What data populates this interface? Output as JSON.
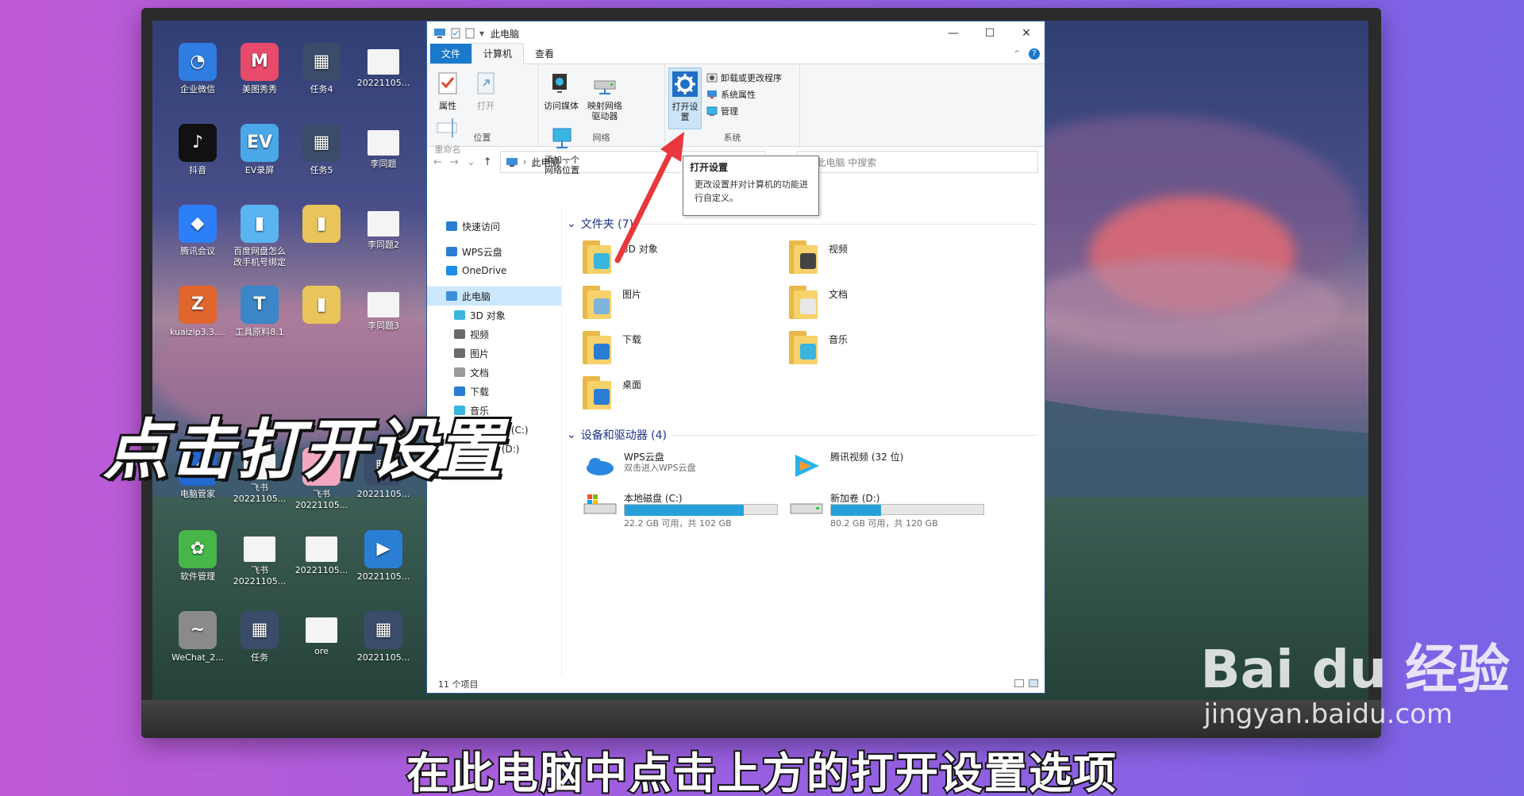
{
  "desktop": {
    "icons": [
      {
        "label": "企业微信",
        "color": "#2f7de1",
        "glyph": "◔"
      },
      {
        "label": "美图秀秀",
        "color": "#e84a6a",
        "glyph": "M"
      },
      {
        "label": "任务4",
        "color": "#3b4c6a",
        "glyph": "▦"
      },
      {
        "label": "20221105...",
        "color": "#f4f4f4",
        "glyph": ""
      },
      {
        "label": "抖音",
        "color": "#111111",
        "glyph": "♪"
      },
      {
        "label": "EV录屏",
        "color": "#4aa8e8",
        "glyph": "EV"
      },
      {
        "label": "任务5",
        "color": "#3b4c6a",
        "glyph": "▦"
      },
      {
        "label": "李同题",
        "color": "#f4f4f4",
        "glyph": ""
      },
      {
        "label": "腾讯会议",
        "color": "#2d7ff9",
        "glyph": "◆"
      },
      {
        "label": "百度网盘怎么改手机号绑定",
        "color": "#5ab4f0",
        "glyph": "▮"
      },
      {
        "label": "",
        "color": "#e8c45a",
        "glyph": "▮"
      },
      {
        "label": "李同题2",
        "color": "#f4f4f4",
        "glyph": ""
      },
      {
        "label": "kuaizip3.3....",
        "color": "#e0662d",
        "glyph": "Z"
      },
      {
        "label": "工具原料8.1",
        "color": "#3a86c8",
        "glyph": "T"
      },
      {
        "label": "",
        "color": "#e8c45a",
        "glyph": "▮"
      },
      {
        "label": "李同题3",
        "color": "#f4f4f4",
        "glyph": ""
      },
      {
        "label": "电脑管家",
        "color": "#2367d1",
        "glyph": "✓"
      },
      {
        "label": "飞书 20221105...",
        "color": "#f4f4f4",
        "glyph": ""
      },
      {
        "label": "飞书 20221105...",
        "color": "#f2a6c0",
        "glyph": "✿"
      },
      {
        "label": "20221105...",
        "color": "#3b4c6a",
        "glyph": "▦"
      },
      {
        "label": "软件管理",
        "color": "#46b649",
        "glyph": "✿"
      },
      {
        "label": "飞书 20221105...",
        "color": "#f4f4f4",
        "glyph": ""
      },
      {
        "label": "20221105...",
        "color": "#f4f4f4",
        "glyph": ""
      },
      {
        "label": "20221105...",
        "color": "#2a7fd4",
        "glyph": "▶"
      },
      {
        "label": "WeChat_2...",
        "color": "#8a8a8a",
        "glyph": "~"
      },
      {
        "label": "任务",
        "color": "#3b4c6a",
        "glyph": "▦"
      },
      {
        "label": "ore",
        "color": "#f4f4f4",
        "glyph": ""
      },
      {
        "label": "20221105...",
        "color": "#3b4c6a",
        "glyph": "▦"
      }
    ]
  },
  "window": {
    "title": "此电脑",
    "controls": {
      "minimize": "—",
      "maximize": "☐",
      "close": "✕"
    },
    "tabs": {
      "file": "文件",
      "computer": "计算机",
      "view": "查看"
    },
    "help": "?",
    "ribbon": {
      "location": {
        "label": "位置",
        "properties": "属性",
        "open": "打开",
        "rename": "重命名"
      },
      "network": {
        "label": "网络",
        "media": "访问媒体",
        "map_drive": "映射网络驱动器",
        "add_location": "添加一个网络位置"
      },
      "system": {
        "label": "系统",
        "settings": "打开设置",
        "uninstall": "卸载或更改程序",
        "sys_props": "系统属性",
        "manage": "管理"
      }
    },
    "nav_bar": {
      "path_root": "此电脑",
      "search_placeholder": "在 此电脑 中搜索"
    },
    "tooltip": {
      "title": "打开设置",
      "desc": "更改设置并对计算机的功能进行自定义。"
    },
    "sidebar": {
      "items": [
        {
          "label": "快速访问",
          "color": "#2b7cd3"
        },
        {
          "label": "WPS云盘",
          "color": "#2b7cd3"
        },
        {
          "label": "OneDrive",
          "color": "#1a8ee6"
        },
        {
          "label": "此电脑",
          "color": "#3b8ed8"
        },
        {
          "label": "3D 对象",
          "color": "#3ab5e0"
        },
        {
          "label": "视频",
          "color": "#6a6a6a"
        },
        {
          "label": "图片",
          "color": "#6a6a6a"
        },
        {
          "label": "文档",
          "color": "#9a9a9a"
        },
        {
          "label": "下载",
          "color": "#2b7cd3"
        },
        {
          "label": "音乐",
          "color": "#3ab5e0"
        },
        {
          "label": "本地磁盘 (C:)",
          "color": "#666666"
        },
        {
          "label": "新加卷 (D:)",
          "color": "#666666"
        },
        {
          "label": "网络",
          "color": "#2b7cd3"
        }
      ]
    },
    "folders_header": "文件夹 (7)",
    "folders": [
      {
        "label": "3D 对象",
        "badge": "#3ab5e0"
      },
      {
        "label": "视频",
        "badge": "#444444"
      },
      {
        "label": "图片",
        "badge": "#7fb3d9"
      },
      {
        "label": "文档",
        "badge": "#e8e8e8"
      },
      {
        "label": "下载",
        "badge": "#2b7cd3"
      },
      {
        "label": "音乐",
        "badge": "#3ab5e0"
      },
      {
        "label": "桌面",
        "badge": "#2b7cd3"
      }
    ],
    "drives_header": "设备和驱动器 (4)",
    "drives": [
      {
        "name": "WPS云盘",
        "sub": "双击进入WPS云盘",
        "fraction": null
      },
      {
        "name": "腾讯视频 (32 位)",
        "sub": "",
        "fraction": null
      },
      {
        "name": "本地磁盘 (C:)",
        "sub": "22.2 GB 可用，共 102 GB",
        "fraction": 0.78
      },
      {
        "name": "新加卷 (D:)",
        "sub": "80.2 GB 可用，共 120 GB",
        "fraction": 0.33
      }
    ],
    "status": "11 个项目"
  },
  "overlay": {
    "title": "点击打开设置",
    "subtitle": "在此电脑中点击上方的打开设置选项",
    "watermark_main": "Bai du 经验",
    "watermark_sub": "jingyan.baidu.com"
  }
}
